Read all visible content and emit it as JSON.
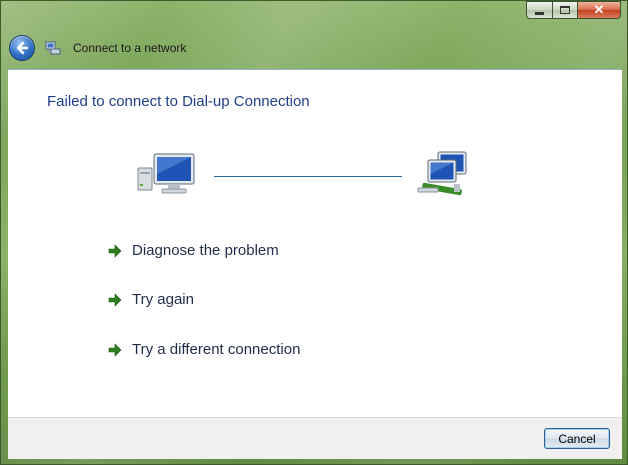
{
  "window": {
    "title": "Connect to a network"
  },
  "content": {
    "heading": "Failed to connect to Dial-up Connection"
  },
  "options": [
    {
      "label": "Diagnose the problem"
    },
    {
      "label": "Try again"
    },
    {
      "label": "Try a different connection"
    }
  ],
  "footer": {
    "cancel_label": "Cancel"
  },
  "colors": {
    "heading": "#1e3f87",
    "link_line": "#2d6aa0",
    "arrow": "#2e7d1f"
  },
  "icons": {
    "caption": [
      "minimize-icon",
      "maximize-icon",
      "close-icon"
    ],
    "nav": [
      "back-arrow-icon",
      "network-icon"
    ],
    "diagram": [
      "computer-icon",
      "network-computers-icon"
    ],
    "option_arrow": "green-arrow-icon"
  }
}
